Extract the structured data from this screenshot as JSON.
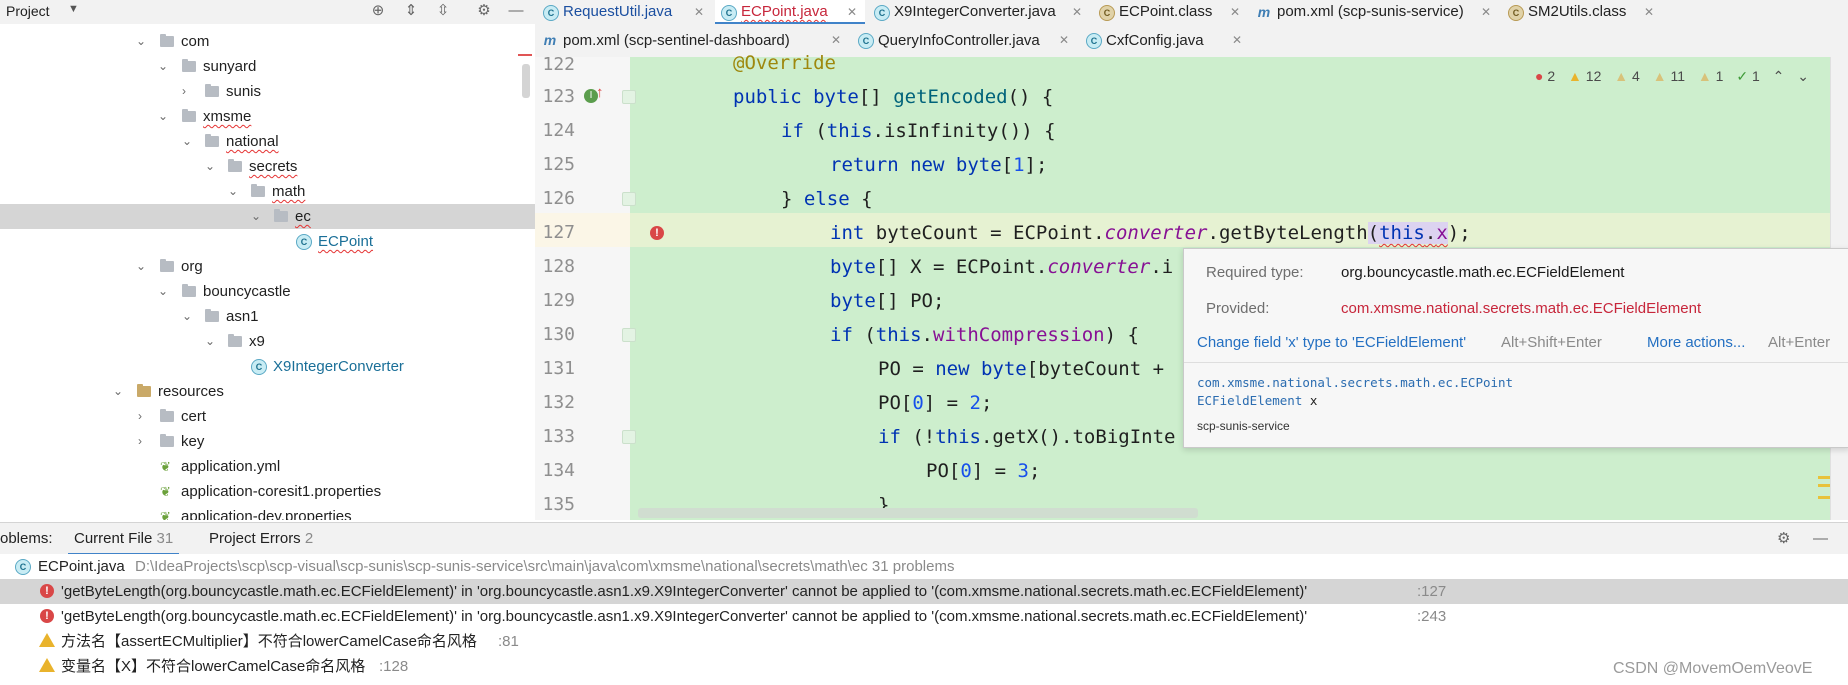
{
  "project": {
    "title": "Project",
    "tree": [
      {
        "label": "com",
        "kind": "folder",
        "squiggle": false
      },
      {
        "label": "sunyard",
        "kind": "folder",
        "squiggle": false
      },
      {
        "label": "sunis",
        "kind": "folder",
        "squiggle": false
      },
      {
        "label": "xmsme",
        "kind": "folder",
        "squiggle": true
      },
      {
        "label": "national",
        "kind": "folder",
        "squiggle": true
      },
      {
        "label": "secrets",
        "kind": "folder",
        "squiggle": true
      },
      {
        "label": "math",
        "kind": "folder",
        "squiggle": true
      },
      {
        "label": "ec",
        "kind": "folder",
        "squiggle": true
      },
      {
        "label": "ECPoint",
        "kind": "class",
        "squiggle": true
      },
      {
        "label": "org",
        "kind": "folder",
        "squiggle": false
      },
      {
        "label": "bouncycastle",
        "kind": "folder",
        "squiggle": false
      },
      {
        "label": "asn1",
        "kind": "folder",
        "squiggle": false
      },
      {
        "label": "x9",
        "kind": "folder",
        "squiggle": false
      },
      {
        "label": "X9IntegerConverter",
        "kind": "class",
        "squiggle": false
      },
      {
        "label": "resources",
        "kind": "resfolder",
        "squiggle": false
      },
      {
        "label": "cert",
        "kind": "folder",
        "squiggle": false
      },
      {
        "label": "key",
        "kind": "folder",
        "squiggle": false
      },
      {
        "label": "application.yml",
        "kind": "yaml",
        "squiggle": false
      },
      {
        "label": "application-coresit1.properties",
        "kind": "yaml",
        "squiggle": false
      },
      {
        "label": "application-dev.properties",
        "kind": "yaml",
        "squiggle": false
      }
    ]
  },
  "tabs_row1": [
    {
      "label": "RequestUtil.java",
      "icon": "C",
      "style": "blue"
    },
    {
      "label": "ECPoint.java",
      "icon": "C",
      "style": "red"
    },
    {
      "label": "X9IntegerConverter.java",
      "icon": "C",
      "style": "normal"
    },
    {
      "label": "ECPoint.class",
      "icon": "C",
      "style": "normal"
    },
    {
      "label": "pom.xml (scp-sunis-service)",
      "icon": "m",
      "style": "normal"
    },
    {
      "label": "SM2Utils.class",
      "icon": "C",
      "style": "normal"
    }
  ],
  "tabs_row2": [
    {
      "label": "pom.xml (scp-sentinel-dashboard)",
      "icon": "m",
      "style": "normal"
    },
    {
      "label": "QueryInfoController.java",
      "icon": "C",
      "style": "normal"
    },
    {
      "label": "CxfConfig.java",
      "icon": "C",
      "style": "normal"
    }
  ],
  "inspections": {
    "errors": "2",
    "warnings": "12",
    "weak_warnings": "4",
    "typos": "11",
    "info": "1",
    "ok": "1"
  },
  "line_numbers": [
    "122",
    "123",
    "124",
    "125",
    "126",
    "127",
    "128",
    "129",
    "130",
    "131",
    "132",
    "133",
    "134",
    "135"
  ],
  "code": {
    "l122": "@Override",
    "l123_kw1": "public",
    "l123_kw2": "byte",
    "l123_rest1": "[] ",
    "l123_fn": "getEncoded",
    "l123_rest2": "() {",
    "l124_kw": "if",
    "l124_mid": " (",
    "l124_this": "this",
    "l124_call": ".isInfinity()) {",
    "l125_kw1": "return",
    "l125_kw2": "new",
    "l125_kw3": "byte",
    "l125_open": "[",
    "l125_num": "1",
    "l125_close": "];",
    "l126": "} ",
    "l126_kw": "else",
    "l126_end": " {",
    "l127_kw": "int",
    "l127_a": " byteCount = ECPoint.",
    "l127_fld": "converter",
    "l127_b": ".getByteLength",
    "l127_paren": "(",
    "l127_this": "this",
    "l127_dot": ".",
    "l127_x": "x",
    "l127_end": ");",
    "l128_kw": "byte",
    "l128_a": "[] X = ECPoint.",
    "l128_fld": "converter",
    "l128_b": ".i",
    "l129_kw": "byte",
    "l129_a": "[] PO;",
    "l130_kw": "if",
    "l130_a": " (",
    "l130_this": "this",
    "l130_dot": ".",
    "l130_fld": "withCompression",
    "l130_b": ") {",
    "l131_a": "PO = ",
    "l131_kw1": "new",
    "l131_kw2": "byte",
    "l131_b": "[byteCount +",
    "l132_a": "PO[",
    "l132_num1": "0",
    "l132_b": "] = ",
    "l132_num2": "2",
    "l132_c": ";",
    "l133_kw": "if",
    "l133_a": " (!",
    "l133_this": "this",
    "l133_b": ".getX().toBigInte",
    "l134_a": "PO[",
    "l134_num1": "0",
    "l134_b": "] = ",
    "l134_num2": "3",
    "l134_c": ";",
    "l135": "}"
  },
  "tooltip": {
    "required_label": "Required type:",
    "required_value": "org.bouncycastle.math.ec.ECFieldElement",
    "provided_label": "Provided:",
    "provided_value": "com.xmsme.national.secrets.math.ec.ECFieldElement",
    "fix_action": "Change field 'x' type to 'ECFieldElement'",
    "fix_shortcut": "Alt+Shift+Enter",
    "more_actions": "More actions...",
    "more_shortcut": "Alt+Enter",
    "decl_class": "com.xmsme.national.secrets.math.ec.ECPoint",
    "decl_type": "ECFieldElement",
    "decl_field": "x",
    "module": "scp-sunis-service"
  },
  "problems": {
    "title": "oblems:",
    "tab_current": "Current File",
    "tab_current_count": "31",
    "tab_project": "Project Errors",
    "tab_project_count": "2",
    "file_name": "ECPoint.java",
    "file_path": "D:\\IdeaProjects\\scp\\scp-visual\\scp-sunis\\scp-sunis-service\\src\\main\\java\\com\\xmsme\\national\\secrets\\math\\ec  31 problems",
    "items": [
      {
        "severity": "error",
        "text": "'getByteLength(org.bouncycastle.math.ec.ECFieldElement)' in 'org.bouncycastle.asn1.x9.X9IntegerConverter' cannot be applied to '(com.xmsme.national.secrets.math.ec.ECFieldElement)'",
        "line": ":127"
      },
      {
        "severity": "error",
        "text": "'getByteLength(org.bouncycastle.math.ec.ECFieldElement)' in 'org.bouncycastle.asn1.x9.X9IntegerConverter' cannot be applied to '(com.xmsme.national.secrets.math.ec.ECFieldElement)'",
        "line": ":243"
      },
      {
        "severity": "warning",
        "text": "方法名【assertECMultiplier】不符合lowerCamelCase命名风格",
        "line": ":81"
      },
      {
        "severity": "warning",
        "text": "变量名【X】不符合lowerCamelCase命名风格",
        "line": ":128"
      }
    ]
  },
  "watermark": "CSDN @MovemOemVeovE"
}
